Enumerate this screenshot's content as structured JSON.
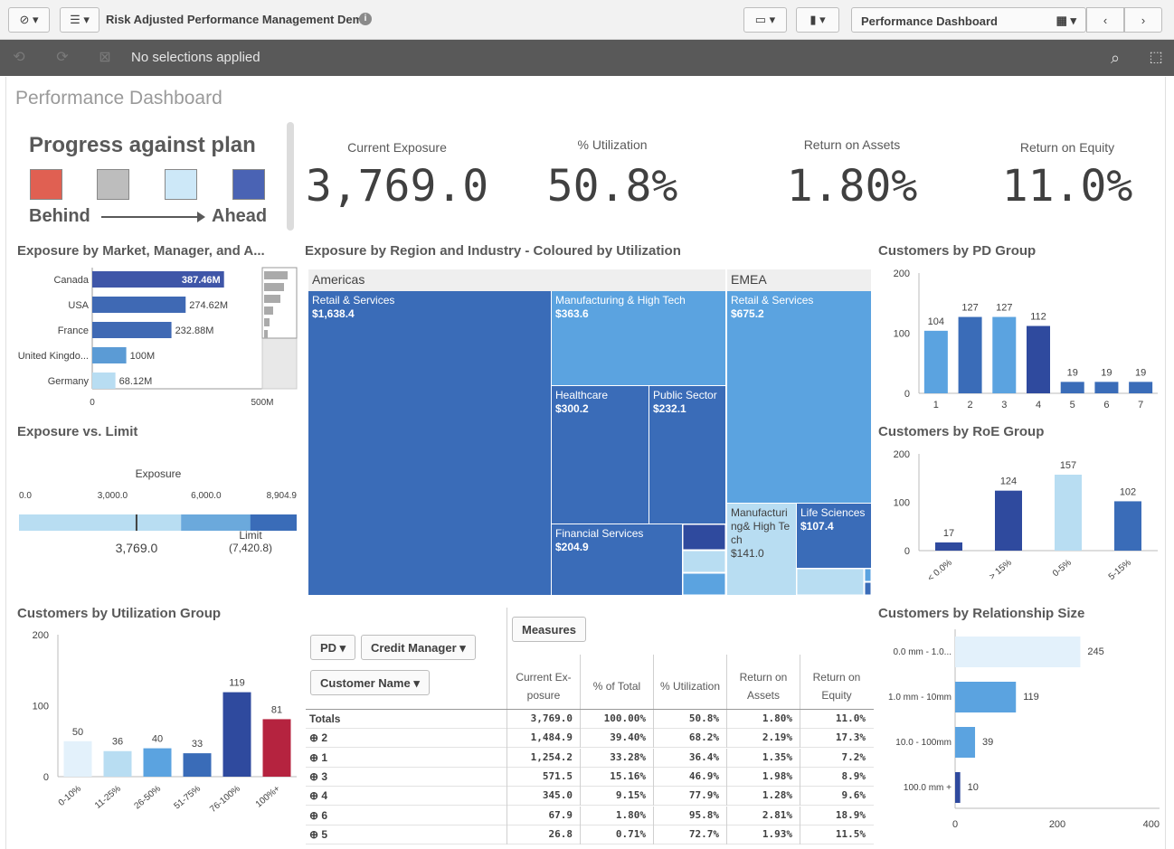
{
  "app": {
    "title": "Risk Adjusted Performance Management Demo",
    "sheet_selector": "Performance Dashboard"
  },
  "selection_bar": {
    "status": "No selections applied"
  },
  "sheet": {
    "title": "Performance Dashboard"
  },
  "legend": {
    "title": "Progress against plan",
    "behind": "Behind",
    "ahead": "Ahead",
    "colors": [
      "#e06052",
      "#bdbdbd",
      "#cde8f8",
      "#4a63b4"
    ]
  },
  "kpis": [
    {
      "label": "Current Exposure",
      "value": "3,769.0"
    },
    {
      "label": "% Utilization",
      "value": "50.8%"
    },
    {
      "label": "Return on Assets",
      "value": "1.80%"
    },
    {
      "label": "Return on Equity",
      "value": "11.0%"
    }
  ],
  "panels": {
    "market": "Exposure by Market, Manager, and A...",
    "treemap": "Exposure by Region and Industry - Coloured by Utilization",
    "pd": "Customers by PD Group",
    "limit": "Exposure vs. Limit",
    "roe": "Customers by RoE Group",
    "util": "Customers by Utilization Group",
    "rel": "Customers by Relationship Size"
  },
  "chart_data": [
    {
      "type": "bar",
      "orientation": "horizontal",
      "categories": [
        "Canada",
        "USA",
        "France",
        "United Kingdo...",
        "Germany"
      ],
      "values": [
        387.46,
        274.62,
        232.88,
        100,
        68.12
      ],
      "data_labels": [
        "387.46M",
        "274.62M",
        "232.88M",
        "100M",
        "68.12M"
      ],
      "x_ticks": [
        "0",
        "500M"
      ],
      "xlim": [
        0,
        500
      ]
    },
    {
      "type": "bar",
      "categories": [
        "1",
        "2",
        "3",
        "4",
        "5",
        "6",
        "7"
      ],
      "values": [
        104,
        127,
        127,
        112,
        19,
        19,
        19
      ],
      "y_ticks": [
        "0",
        "100",
        "200"
      ],
      "ylim": [
        0,
        200
      ]
    },
    {
      "type": "bar",
      "categories": [
        "< 0.0%",
        "> 15%",
        "0-5%",
        "5-15%"
      ],
      "values": [
        17,
        124,
        157,
        102
      ],
      "y_ticks": [
        "0",
        "100",
        "200"
      ],
      "ylim": [
        0,
        200
      ]
    },
    {
      "type": "bar",
      "categories": [
        "0-10%",
        "11-25%",
        "26-50%",
        "51-75%",
        "76-100%",
        "100%+"
      ],
      "values": [
        50,
        36,
        40,
        33,
        119,
        81
      ],
      "y_ticks": [
        "0",
        "100",
        "200"
      ],
      "ylim": [
        0,
        200
      ]
    },
    {
      "type": "bar",
      "orientation": "horizontal",
      "categories": [
        "0.0 mm - 1.0...",
        "1.0 mm - 10mm",
        "10.0 - 100mm",
        "100.0 mm +"
      ],
      "values": [
        245,
        119,
        39,
        10
      ],
      "x_ticks": [
        "0",
        "200",
        "400"
      ],
      "xlim": [
        0,
        400
      ]
    },
    {
      "type": "bullet",
      "title": "Exposure",
      "axis_ticks": [
        "0.0",
        "3,000.0",
        "6,000.0",
        "8,904.9"
      ],
      "value": 3769.0,
      "value_label": "3,769.0",
      "limit_label": "Limit",
      "limit_value": "(7,420.8)",
      "max": 8904.9
    },
    {
      "type": "treemap",
      "regions": [
        {
          "name": "Americas",
          "items": [
            {
              "name": "Retail & Services",
              "value": "$1,638.4"
            },
            {
              "name": "Manufacturing & High Tech",
              "value": "$363.6"
            },
            {
              "name": "Healthcare",
              "value": "$300.2"
            },
            {
              "name": "Public Sector",
              "value": "$232.1"
            },
            {
              "name": "Financial Services",
              "value": "$204.9"
            }
          ]
        },
        {
          "name": "EMEA",
          "items": [
            {
              "name": "Retail & Services",
              "value": "$675.2"
            },
            {
              "name": "Manufacturing& High Tech",
              "value": "$141.0"
            },
            {
              "name": "Life Sciences",
              "value": "$107.4"
            }
          ]
        }
      ]
    },
    {
      "type": "table",
      "dimensions": [
        "PD",
        "Credit Manager",
        "Customer Name"
      ],
      "measures_button": "Measures",
      "columns": [
        "Current Ex-posure",
        "% of Total",
        "% Utilization",
        "Return on Assets",
        "Return on Equity"
      ],
      "totals": {
        "label": "Totals",
        "values": [
          "3,769.0",
          "100.00%",
          "50.8%",
          "1.80%",
          "11.0%"
        ]
      },
      "rows": [
        {
          "key": "2",
          "values": [
            "1,484.9",
            "39.40%",
            "68.2%",
            "2.19%",
            "17.3%"
          ]
        },
        {
          "key": "1",
          "values": [
            "1,254.2",
            "33.28%",
            "36.4%",
            "1.35%",
            "7.2%"
          ]
        },
        {
          "key": "3",
          "values": [
            "571.5",
            "15.16%",
            "46.9%",
            "1.98%",
            "8.9%"
          ]
        },
        {
          "key": "4",
          "values": [
            "345.0",
            "9.15%",
            "77.9%",
            "1.28%",
            "9.6%"
          ]
        },
        {
          "key": "6",
          "values": [
            "67.9",
            "1.80%",
            "95.8%",
            "2.81%",
            "18.9%"
          ]
        },
        {
          "key": "5",
          "values": [
            "26.8",
            "0.71%",
            "72.7%",
            "1.93%",
            "11.5%"
          ]
        }
      ]
    }
  ]
}
